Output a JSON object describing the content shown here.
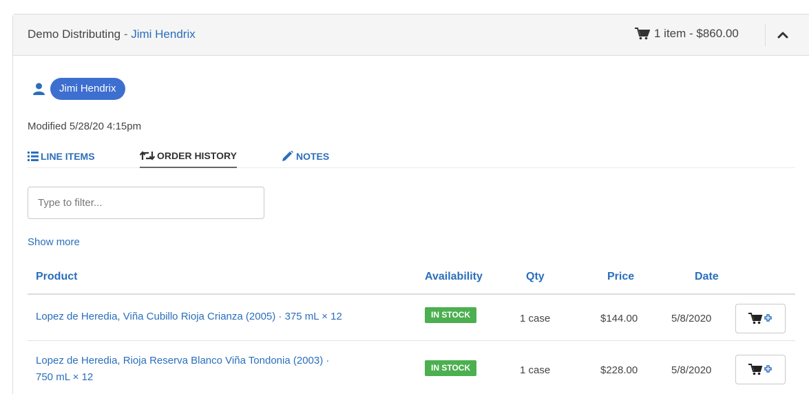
{
  "header": {
    "distributor": "Demo Distributing",
    "separator": " - ",
    "customer": "Jimi Hendrix",
    "cart_summary": "1 item - $860.00",
    "icons": {
      "cart": "cart-icon",
      "collapse": "chevron-up-icon"
    }
  },
  "customer_pill": {
    "label": "Jimi Hendrix",
    "icon": "user-icon"
  },
  "modified": "Modified 5/28/20 4:15pm",
  "tabs": [
    {
      "label": "LINE ITEMS",
      "icon": "list-icon",
      "active": false
    },
    {
      "label": "ORDER HISTORY",
      "icon": "retweet-icon",
      "active": true
    },
    {
      "label": "NOTES",
      "icon": "pencil-icon",
      "active": false
    }
  ],
  "filter": {
    "placeholder": "Type to filter...",
    "value": ""
  },
  "show_more": "Show more",
  "table": {
    "columns": [
      "Product",
      "Availability",
      "Qty",
      "Price",
      "Date"
    ],
    "rows": [
      {
        "product": "Lopez de Heredia, Viña Cubillo Rioja Crianza (2005) · 375 mL × 12",
        "availability": "IN STOCK",
        "qty": "1 case",
        "price": "$144.00",
        "date": "5/8/2020"
      },
      {
        "product_line1": "Lopez de Heredia, Rioja Reserva Blanco Viña Tondonia (2003) ·",
        "product_line2": "750 mL × 12",
        "availability": "IN STOCK",
        "qty": "1 case",
        "price": "$228.00",
        "date": "5/8/2020"
      }
    ]
  },
  "colors": {
    "link": "#2a6ebb",
    "pill": "#3d6fd0",
    "in_stock": "#4caf50"
  }
}
